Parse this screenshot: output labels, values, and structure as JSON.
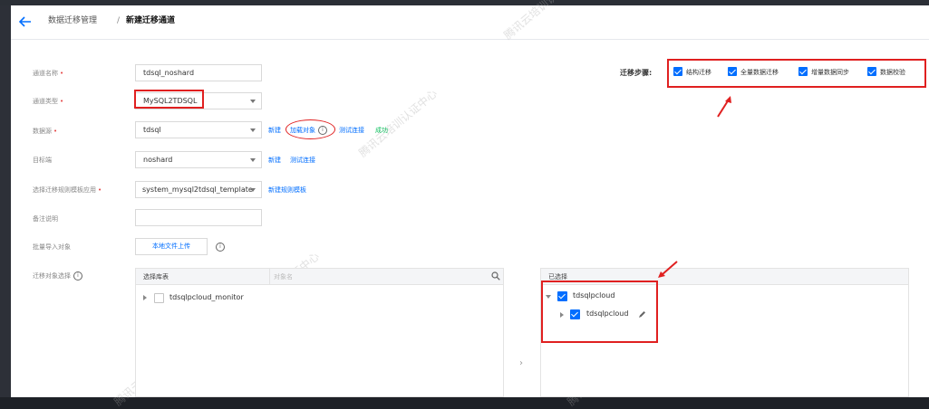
{
  "header": {
    "breadcrumb_parent": "数据迁移管理",
    "breadcrumb_sep": "/",
    "breadcrumb_current": "新建迁移通道"
  },
  "form": {
    "channel_name": {
      "label": "通道名称",
      "required": "•",
      "value": "tdsql_noshard"
    },
    "channel_type": {
      "label": "通道类型",
      "required": "•",
      "value": "MySQL2TDSQL"
    },
    "source": {
      "label": "数据源",
      "required": "•",
      "value": "tdsql",
      "new_link": "新建",
      "load_link": "加载对象",
      "test_link": "测试连接",
      "status": "成功"
    },
    "target": {
      "label": "目标端",
      "value": "noshard",
      "new_link": "新建",
      "test_link": "测试连接"
    },
    "template": {
      "label": "选择迁移规则模板应用",
      "required": "•",
      "value": "system_mysql2tdsql_template",
      "new_link": "新建规则模板"
    },
    "remark": {
      "label": "备注说明",
      "value": ""
    },
    "batch_import": {
      "label": "批量导入对象",
      "button": "本地文件上传"
    },
    "object_select": {
      "label": "迁移对象选择"
    }
  },
  "steps": {
    "label": "迁移步骤:",
    "items": [
      {
        "label": "结构迁移",
        "checked": true
      },
      {
        "label": "全量数据迁移",
        "checked": true
      },
      {
        "label": "增量数据同步",
        "checked": true
      },
      {
        "label": "数据校验",
        "checked": true
      }
    ]
  },
  "left_panel": {
    "header": "选择库表",
    "search_placeholder": "对象名",
    "items": [
      {
        "label": "tdsqlpcloud_monitor",
        "checked": false
      }
    ]
  },
  "right_panel": {
    "header": "已选择",
    "items": [
      {
        "label": "tdsqlpcloud",
        "checked": true,
        "level": 0
      },
      {
        "label": "tdsqlpcloud",
        "checked": true,
        "level": 1
      }
    ]
  },
  "transfer_arrow": "›",
  "info_icon_glyph": "i",
  "watermark": "腾讯云培训认证中心",
  "colors": {
    "accent": "#006eff",
    "success": "#0abf5b",
    "annotation": "#e02020",
    "required": "#e54545"
  }
}
